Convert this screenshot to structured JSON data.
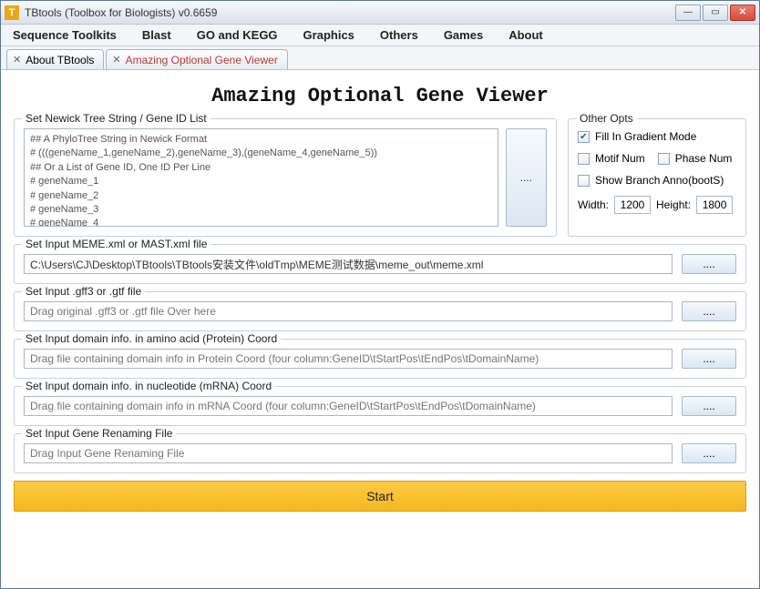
{
  "window": {
    "title": "TBtools (Toolbox for Biologists) v0.6659",
    "min_icon": "—",
    "max_icon": "▭",
    "close_icon": "✕"
  },
  "menubar": {
    "items": [
      "Sequence Toolkits",
      "Blast",
      "GO and KEGG",
      "Graphics",
      "Others",
      "Games",
      "About"
    ]
  },
  "tabs": {
    "close_glyph": "✕",
    "items": [
      {
        "label": "About TBtools",
        "active": true
      },
      {
        "label": "Amazing Optional Gene Viewer",
        "active": false
      }
    ]
  },
  "page": {
    "title": "Amazing Optional Gene Viewer"
  },
  "newick_panel": {
    "legend": "Set Newick Tree String / Gene ID List",
    "textarea_value": "## A PhyloTree String in Newick Format\n# (((geneName_1,geneName_2),geneName_3),(geneName_4,geneName_5))\n## Or a List of Gene ID, One ID Per Line\n# geneName_1\n# geneName_2\n# geneName_3\n# geneName_4",
    "side_btn": "...."
  },
  "other_opts": {
    "legend": "Other Opts",
    "fill_gradient": {
      "label": "Fill In Gradient Mode",
      "checked": true
    },
    "motif_num": {
      "label": "Motif Num",
      "checked": false
    },
    "phase_num": {
      "label": "Phase Num",
      "checked": false
    },
    "branch_anno": {
      "label": "Show Branch Anno(bootS)",
      "checked": false
    },
    "width_label": "Width:",
    "width_value": "1200",
    "height_label": "Height:",
    "height_value": "1800"
  },
  "file_sections": [
    {
      "legend": "Set Input MEME.xml or MAST.xml file",
      "value": "C:\\Users\\CJ\\Desktop\\TBtools\\TBtools安装文件\\oldTmp\\MEME测试数据\\meme_out\\meme.xml",
      "placeholder": "",
      "btn": "...."
    },
    {
      "legend": "Set Input .gff3 or .gtf file",
      "value": "",
      "placeholder": "Drag original .gff3 or .gtf file Over here",
      "btn": "...."
    },
    {
      "legend": "Set Input domain info. in amino acid (Protein) Coord",
      "value": "",
      "placeholder": "Drag file containing domain info in Protein Coord (four column:GeneID\\tStartPos\\tEndPos\\tDomainName)",
      "btn": "...."
    },
    {
      "legend": "Set Input domain info. in nucleotide (mRNA) Coord",
      "value": "",
      "placeholder": "Drag file containing domain info in mRNA Coord (four column:GeneID\\tStartPos\\tEndPos\\tDomainName)",
      "btn": "...."
    },
    {
      "legend": "Set Input Gene Renaming File",
      "value": "",
      "placeholder": "Drag Input Gene Renaming File",
      "btn": "...."
    }
  ],
  "start_button": {
    "label": "Start"
  },
  "check_glyph": "✔"
}
